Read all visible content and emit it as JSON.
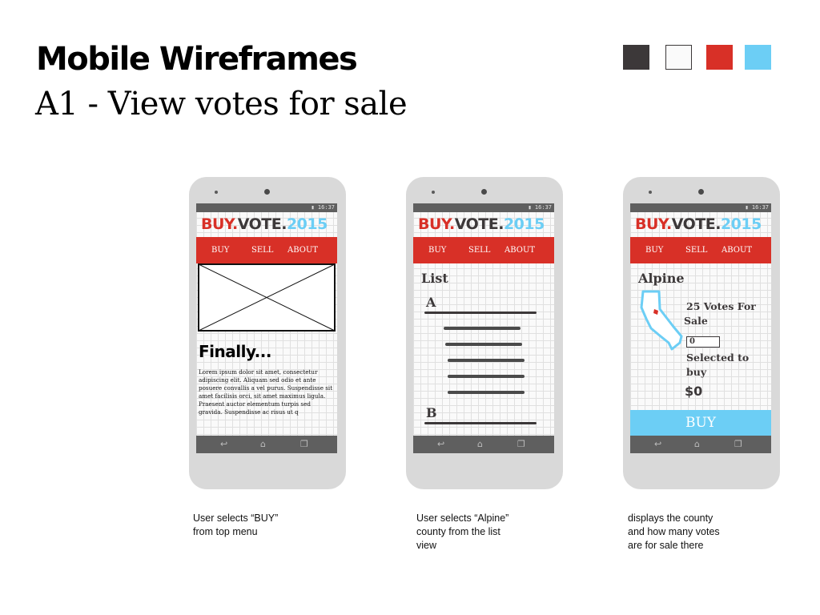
{
  "page": {
    "title": "Mobile Wireframes",
    "subtitle": "A1 - View votes for sale"
  },
  "palette": [
    "#3c3839",
    "#fafafa",
    "#d83027",
    "#6ccef5"
  ],
  "app": {
    "logo_buy": "BUY.",
    "logo_vote": "VOTE.",
    "logo_year": "2015",
    "nav": [
      "BUY",
      "SELL",
      "ABOUT"
    ],
    "status_time": "16:37"
  },
  "screens": [
    {
      "heading": "Finally...",
      "body": "Lorem ipsum dolor sit amet, consectetur adipiscing elit. Aliquam sed odio et ante posuere convallis a vel purus. Suspendisse sit amet facilisis orci, sit amet maximus ligula. Praesent auctor elementum turpis sed gravida. Suspendisse ac risus ut q",
      "caption": [
        "User selects “BUY”",
        "from top menu"
      ]
    },
    {
      "list_title": "List",
      "letters": [
        "A",
        "B"
      ],
      "caption": [
        "User selects “Alpine”",
        "county from the list",
        "view"
      ]
    },
    {
      "county": "Alpine",
      "votes_line1": "25 Votes For",
      "votes_line2": "Sale",
      "quantity": "0",
      "selected_line1": "Selected to",
      "selected_line2": "buy",
      "price": "$0",
      "buy_button": "BUY",
      "caption": [
        "displays the county",
        "and how many votes",
        "are for sale there"
      ]
    }
  ]
}
